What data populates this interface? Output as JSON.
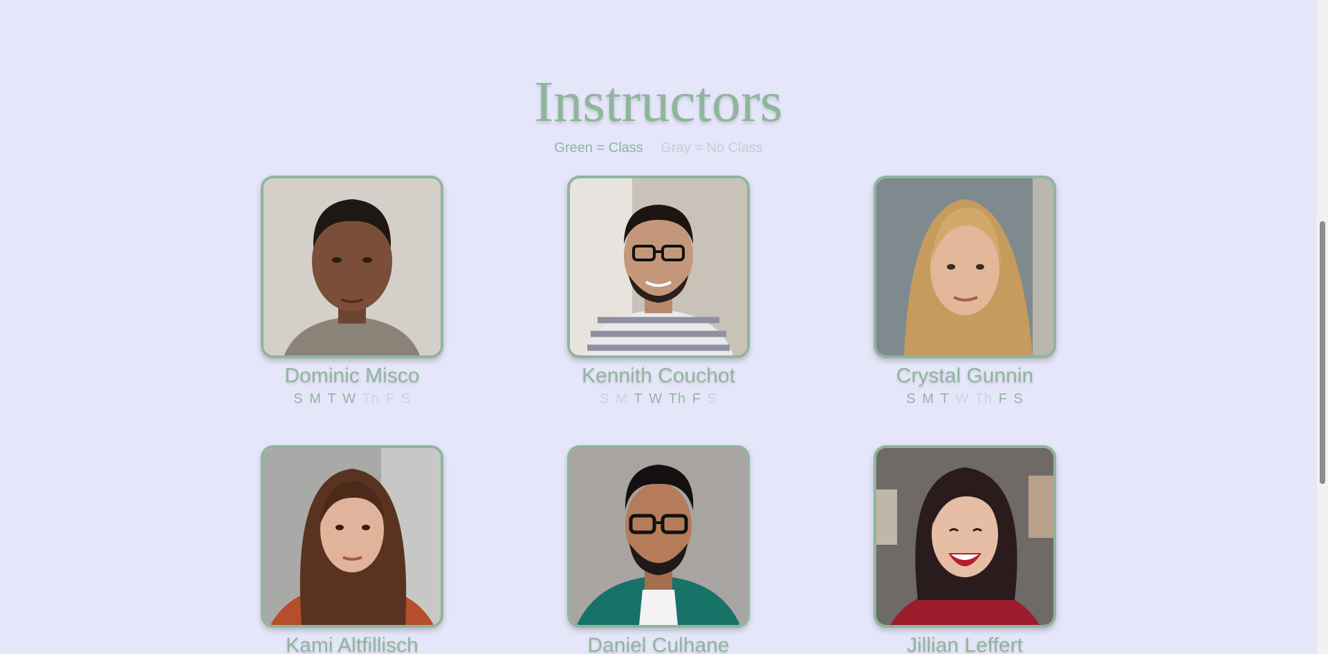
{
  "page": {
    "title": "Instructors",
    "legend": {
      "green": "Green = Class",
      "gray": "Gray = No Class"
    }
  },
  "instructors": [
    {
      "name": "Dominic Misco",
      "days": [
        {
          "label": "S",
          "on": true
        },
        {
          "label": "M",
          "on": true
        },
        {
          "label": "T",
          "on": true
        },
        {
          "label": "W",
          "on": true
        },
        {
          "label": "Th",
          "on": false
        },
        {
          "label": "F",
          "on": false
        },
        {
          "label": "S",
          "on": false
        }
      ]
    },
    {
      "name": "Kennith Couchot",
      "days": [
        {
          "label": "S",
          "on": false
        },
        {
          "label": "M",
          "on": false
        },
        {
          "label": "T",
          "on": true
        },
        {
          "label": "W",
          "on": true
        },
        {
          "label": "Th",
          "on": true
        },
        {
          "label": "F",
          "on": true
        },
        {
          "label": "S",
          "on": false
        }
      ]
    },
    {
      "name": "Crystal Gunnin",
      "days": [
        {
          "label": "S",
          "on": true
        },
        {
          "label": "M",
          "on": true
        },
        {
          "label": "T",
          "on": true
        },
        {
          "label": "W",
          "on": false
        },
        {
          "label": "Th",
          "on": false
        },
        {
          "label": "F",
          "on": true
        },
        {
          "label": "S",
          "on": true
        }
      ]
    },
    {
      "name": "Kami Altfillisch",
      "days": []
    },
    {
      "name": "Daniel Culhane",
      "days": []
    },
    {
      "name": "Jillian Leffert",
      "days": []
    }
  ],
  "colors": {
    "background": "#e6e6fa",
    "accent": "#8fb59d",
    "inactive": "#cfd2da"
  }
}
